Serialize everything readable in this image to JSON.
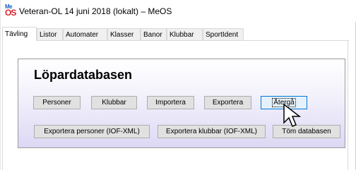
{
  "window": {
    "title": "Veteran-OL 14 juni 2018 (lokalt) – MeOS",
    "icon_top": "Me",
    "icon_bottom": "OS"
  },
  "tabs": [
    {
      "label": "Tävling",
      "active": true
    },
    {
      "label": "Listor"
    },
    {
      "label": "Automater"
    },
    {
      "label": "Klasser"
    },
    {
      "label": "Banor"
    },
    {
      "label": "Klubbar"
    },
    {
      "label": "SportIdent"
    }
  ],
  "panel": {
    "heading": "Löpardatabasen",
    "row1": [
      "Personer",
      "Klubbar",
      "Importera",
      "Exportera",
      "Återgå"
    ],
    "row2": [
      "Exportera personer (IOF-XML)",
      "Exportera klubbar (IOF-XML)",
      "Töm databasen"
    ]
  },
  "colors": {
    "icon_me": "#1a5dc7",
    "icon_os": "#d4262c",
    "panel_gradient_end": "#dcd8f4",
    "focus_border": "#0078d7"
  }
}
